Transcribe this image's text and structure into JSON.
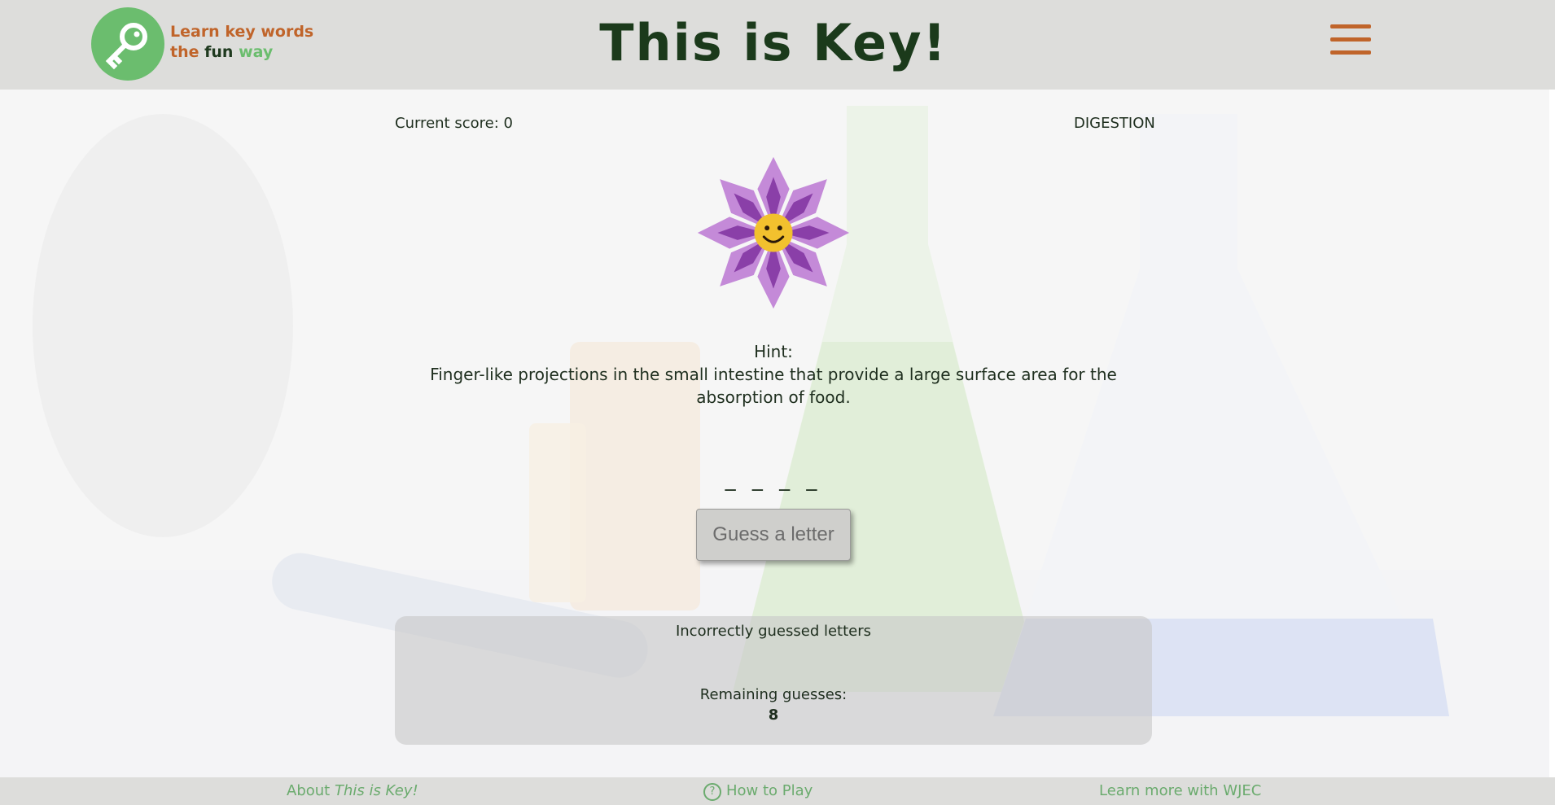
{
  "header": {
    "tagline_line1": "Learn key words",
    "tagline_the": "the",
    "tagline_fun": "fun",
    "tagline_way": "way",
    "title": "This is Key!",
    "logo_icon": "key-icon",
    "menu_icon": "hamburger-menu-icon"
  },
  "game": {
    "score_text": "Current score: 0",
    "topic": "DIGESTION",
    "mascot": "smiling-flower",
    "hint_label": "Hint:",
    "hint_text": "Finger-like projections in the small intestine that provide a large surface area for the absorption of food.",
    "blanks": "_ _ _ _ _",
    "guess_button_label": "Guess a letter",
    "incorrect_label": "Incorrectly guessed letters",
    "remaining_label": "Remaining guesses:",
    "remaining_value": "8"
  },
  "footer": {
    "about_prefix": "About ",
    "about_title": "This is Key!",
    "how_to_play": "How to Play",
    "how_icon": "question-circle-icon",
    "wjec": "Learn more with WJEC"
  },
  "colors": {
    "accent_orange": "#c0642a",
    "accent_green": "#6bbd6e",
    "title_dark_green": "#1b3a1b"
  }
}
